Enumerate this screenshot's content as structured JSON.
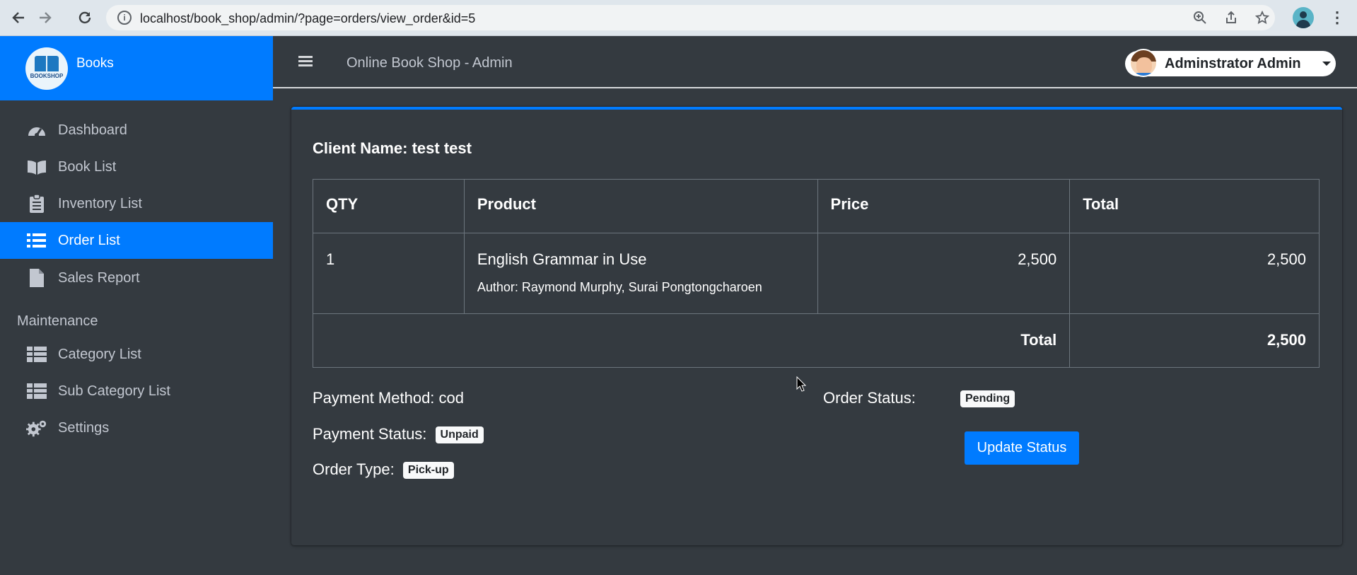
{
  "browser": {
    "url": "localhost/book_shop/admin/?page=orders/view_order&id=5"
  },
  "sidebar": {
    "brand": "Books",
    "logo_text": "BOOKSHOP",
    "items": [
      {
        "label": "Dashboard",
        "icon": "tachometer-icon"
      },
      {
        "label": "Book List",
        "icon": "book-open-icon"
      },
      {
        "label": "Inventory List",
        "icon": "clipboard-list-icon"
      },
      {
        "label": "Order List",
        "icon": "list-icon",
        "active": true
      },
      {
        "label": "Sales Report",
        "icon": "file-icon"
      }
    ],
    "section_header": "Maintenance",
    "maintenance_items": [
      {
        "label": "Category List",
        "icon": "table-icon"
      },
      {
        "label": "Sub Category List",
        "icon": "table-icon"
      },
      {
        "label": "Settings",
        "icon": "gears-icon"
      }
    ]
  },
  "topnav": {
    "title": "Online Book Shop - Admin",
    "user_name": "Adminstrator Admin"
  },
  "order": {
    "client_name": "Client Name: test test",
    "columns": [
      "QTY",
      "Product",
      "Price",
      "Total"
    ],
    "items": [
      {
        "qty": "1",
        "product": "English Grammar in Use",
        "author": "Author: Raymond Murphy, Surai Pongtongcharoen",
        "price": "2,500",
        "total": "2,500"
      }
    ],
    "total_label": "Total",
    "total_value": "2,500",
    "payment_method": "Payment Method: cod",
    "payment_status_label": "Payment Status:",
    "payment_status": "Unpaid",
    "order_type_label": "Order Type:",
    "order_type": "Pick-up",
    "order_status_label": "Order Status:",
    "order_status": "Pending",
    "update_button": "Update Status"
  },
  "colors": {
    "accent": "#007bff",
    "background": "#343a40",
    "sidebar_text": "#c2c7d0"
  }
}
